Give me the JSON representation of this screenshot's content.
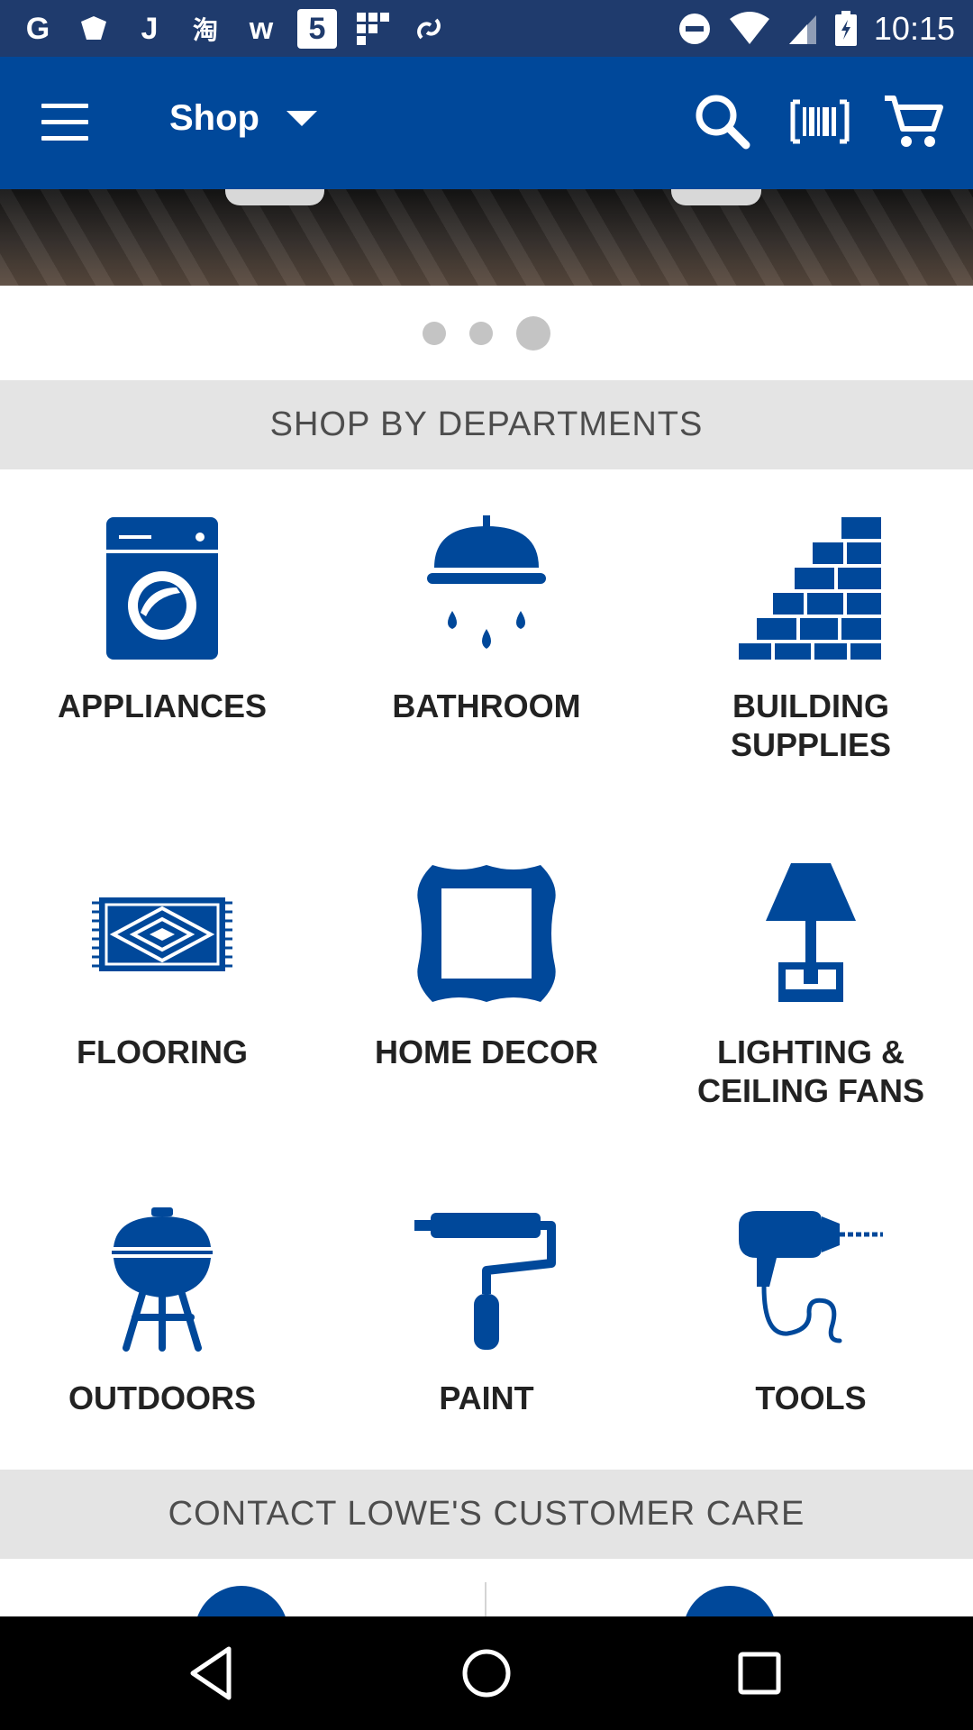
{
  "status_bar": {
    "time": "10:15",
    "notification_icons": [
      "G",
      "shield-icon",
      "J",
      "淘",
      "w",
      "5",
      "grid-icon",
      "link-icon"
    ]
  },
  "app_bar": {
    "title": "Shop",
    "icons": [
      "menu-icon",
      "search-icon",
      "barcode-icon",
      "cart-icon"
    ]
  },
  "carousel": {
    "page_count": 3,
    "active_page": 3
  },
  "departments": {
    "header": "SHOP BY DEPARTMENTS",
    "items": [
      {
        "label": "APPLIANCES",
        "icon": "washer-icon"
      },
      {
        "label": "BATHROOM",
        "icon": "shower-icon"
      },
      {
        "label": "BUILDING\nSUPPLIES",
        "icon": "bricks-icon"
      },
      {
        "label": "FLOORING",
        "icon": "rug-icon"
      },
      {
        "label": "HOME DECOR",
        "icon": "frame-icon"
      },
      {
        "label": "LIGHTING &\nCEILING FANS",
        "icon": "lamp-icon"
      },
      {
        "label": "OUTDOORS",
        "icon": "grill-icon"
      },
      {
        "label": "PAINT",
        "icon": "paint-roller-icon"
      },
      {
        "label": "TOOLS",
        "icon": "drill-icon"
      }
    ]
  },
  "contact": {
    "header": "CONTACT LOWE'S CUSTOMER CARE"
  },
  "colors": {
    "status_bar": "#1f3b6d",
    "brand_blue": "#00489a",
    "section_bg": "#e4e4e4",
    "dot": "#c4c4c4"
  }
}
